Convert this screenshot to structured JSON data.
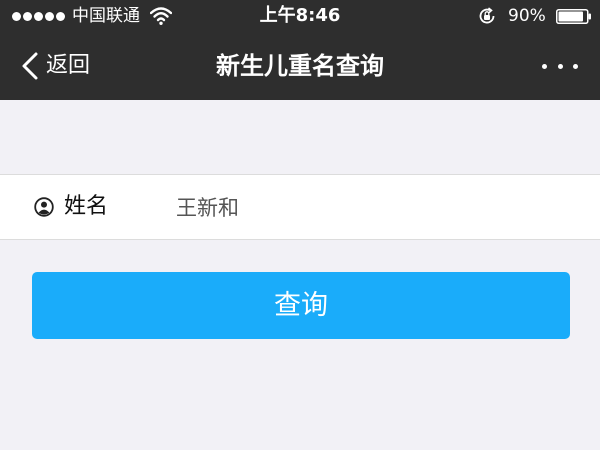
{
  "status_bar": {
    "carrier": "中国联通",
    "time": "上午8:46",
    "battery": "90%"
  },
  "nav": {
    "back_label": "返回",
    "title": "新生儿重名查询"
  },
  "form": {
    "name_label": "姓名",
    "name_value": "王新和"
  },
  "query_button_label": "查询",
  "icons": [
    "wifi-icon",
    "rotation-lock-icon",
    "battery-icon",
    "back-chevron-icon",
    "more-icon",
    "person-icon"
  ],
  "colors": {
    "nav_bar": "#2e2e2e",
    "page_background": "#f2f1f6",
    "button": "#1aacfa"
  }
}
